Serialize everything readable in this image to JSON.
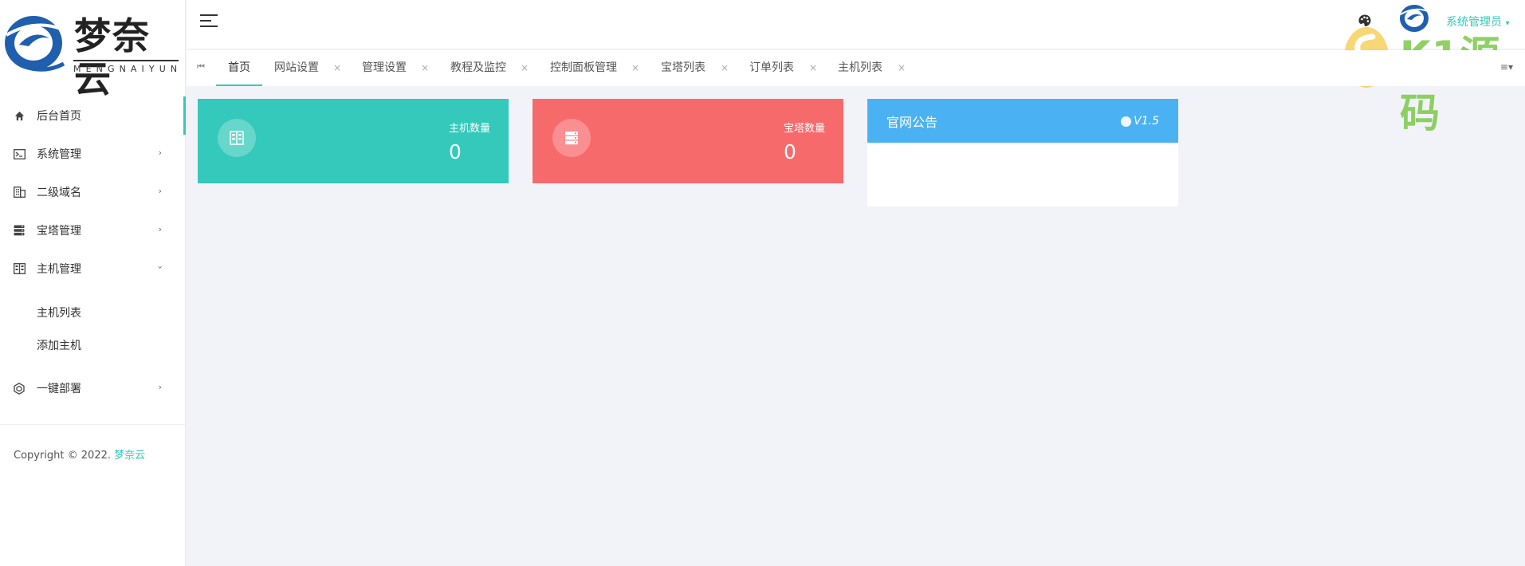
{
  "brand": {
    "name": "梦奈云",
    "subtitle": "MENGNAIYUN"
  },
  "sidebar": {
    "items": [
      {
        "label": "后台首页",
        "icon": "home-icon"
      },
      {
        "label": "系统管理",
        "icon": "terminal-icon"
      },
      {
        "label": "二级域名",
        "icon": "building-icon"
      },
      {
        "label": "宝塔管理",
        "icon": "server-icon"
      },
      {
        "label": "主机管理",
        "icon": "host-icon"
      },
      {
        "label": "一键部署",
        "icon": "cube-icon"
      }
    ],
    "submenu": [
      {
        "label": "主机列表"
      },
      {
        "label": "添加主机"
      }
    ],
    "copyright_prefix": "Copyright © 2022. ",
    "copyright_link": "梦奈云"
  },
  "header": {
    "admin_name": "系统管理员",
    "admin_caret": "▾"
  },
  "tabs": [
    {
      "label": "首页"
    },
    {
      "label": "网站设置"
    },
    {
      "label": "管理设置"
    },
    {
      "label": "教程及监控"
    },
    {
      "label": "控制面板管理"
    },
    {
      "label": "宝塔列表"
    },
    {
      "label": "订单列表"
    },
    {
      "label": "主机列表"
    }
  ],
  "tab_close": "×",
  "tabs_menu": "≡▾",
  "cards": {
    "hosts": {
      "label": "主机数量",
      "value": "0",
      "color": "#34c9ba"
    },
    "bt": {
      "label": "宝塔数量",
      "value": "0",
      "color": "#f76a6c"
    }
  },
  "notice": {
    "title": "官网公告",
    "version": "V1.5",
    "color": "#4ab2f2"
  },
  "watermark": {
    "text": "K1源码",
    "url": "k1ym.com"
  },
  "colors": {
    "accent": "#33c9ba"
  }
}
